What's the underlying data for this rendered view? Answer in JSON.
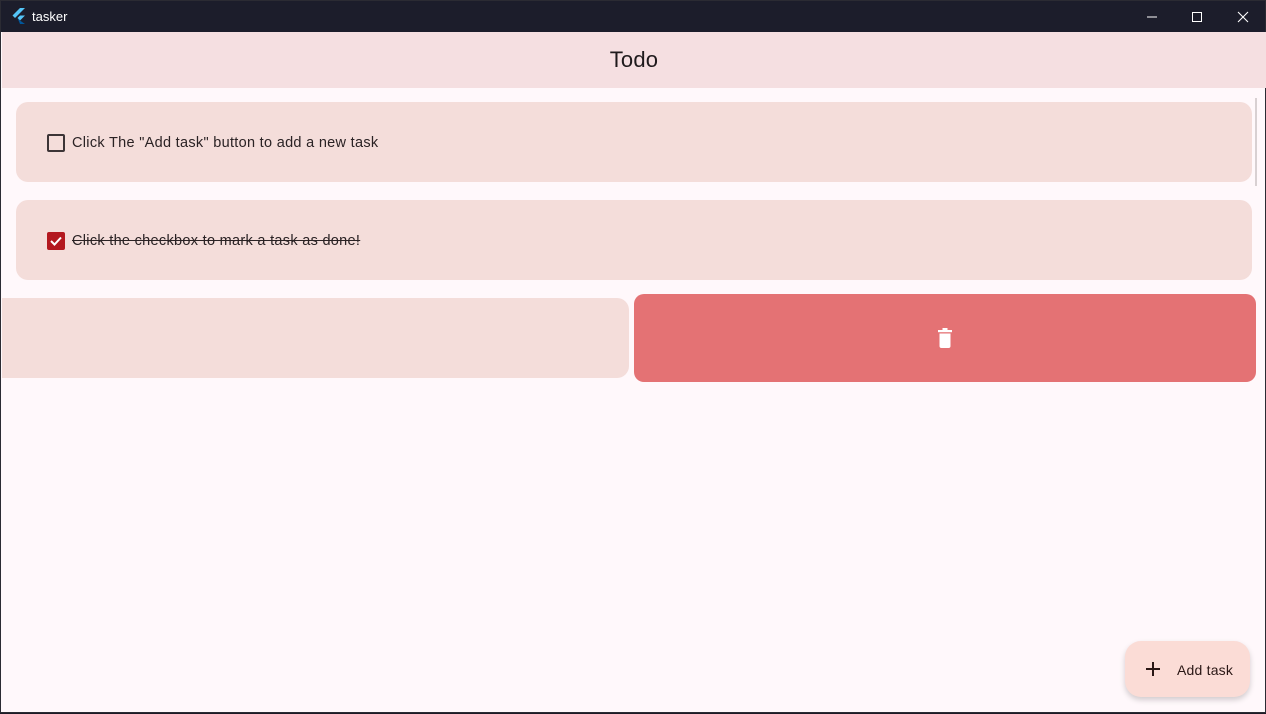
{
  "window": {
    "title": "tasker",
    "controls": {
      "minimize_icon": "minimize-icon",
      "maximize_icon": "maximize-icon",
      "close_icon": "close-icon"
    }
  },
  "appbar": {
    "title": "Todo"
  },
  "tasks": [
    {
      "text": "Click The \"Add task\" button to add a new task",
      "done": false
    },
    {
      "text": "Click the checkbox to mark a task as done!",
      "done": true
    }
  ],
  "swipe_action": {
    "icon": "trash-icon",
    "color": "#e47274"
  },
  "fab": {
    "icon": "plus-icon",
    "label": "Add task"
  },
  "colors": {
    "appbar_bg": "#f5dfe1",
    "card_bg": "#f4ddda",
    "checkbox_checked": "#b3181f",
    "fab_bg": "#fbdcd6",
    "page_bg": "#fff8fb"
  }
}
